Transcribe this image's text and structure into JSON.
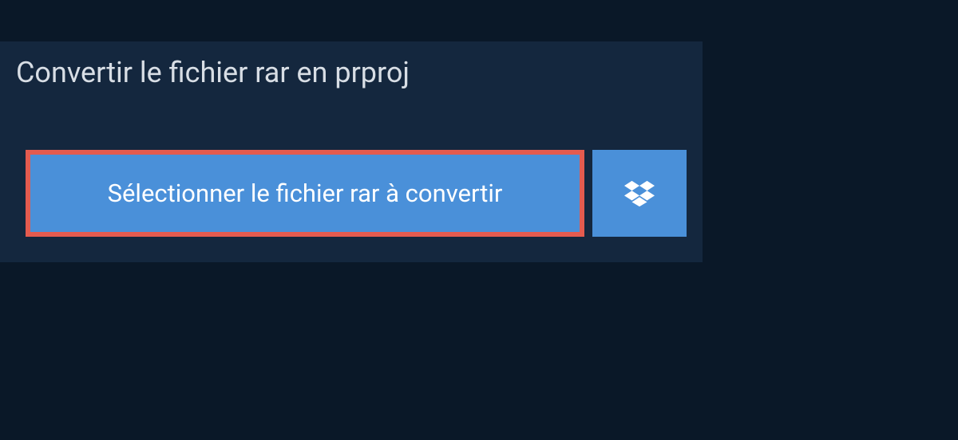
{
  "header": {
    "title": "Convertir le fichier rar en prproj"
  },
  "actions": {
    "select_button_label": "Sélectionner le fichier rar à convertir"
  }
}
